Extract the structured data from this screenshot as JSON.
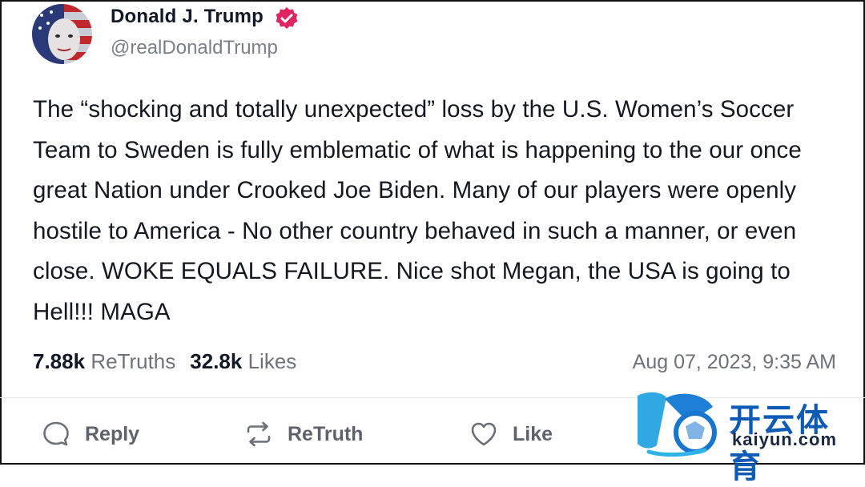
{
  "post": {
    "author_name": "Donald J. Trump",
    "handle": "@realDonaldTrump",
    "text": "The “shocking and totally unexpected” loss by the U.S. Women’s Soccer Team to Sweden is fully emblematic of what is happening to the our once great Nation under Crooked Joe Biden. Many of our players were openly hostile to America - No other country behaved in such a manner, or even close. WOKE EQUALS FAILURE. Nice shot Megan, the USA is going to Hell!!! MAGA",
    "retruths_count": "7.88k",
    "retruths_label": "ReTruths",
    "likes_count": "32.8k",
    "likes_label": "Likes",
    "timestamp": "Aug 07, 2023, 9:35 AM"
  },
  "actions": {
    "reply_label": "Reply",
    "retruth_label": "ReTruth",
    "like_label": "Like"
  },
  "watermark": {
    "chinese_text": "开云体育",
    "url_text": "kaiyun.com"
  },
  "colors": {
    "verified_badge": "#e0245e",
    "muted_text": "#6e727a",
    "watermark_blue": "#0d5bb5"
  },
  "icons": {
    "verified": "verified-badge-icon",
    "reply": "speech-bubble-icon",
    "retruth": "retruth-arrows-icon",
    "like": "heart-icon"
  }
}
